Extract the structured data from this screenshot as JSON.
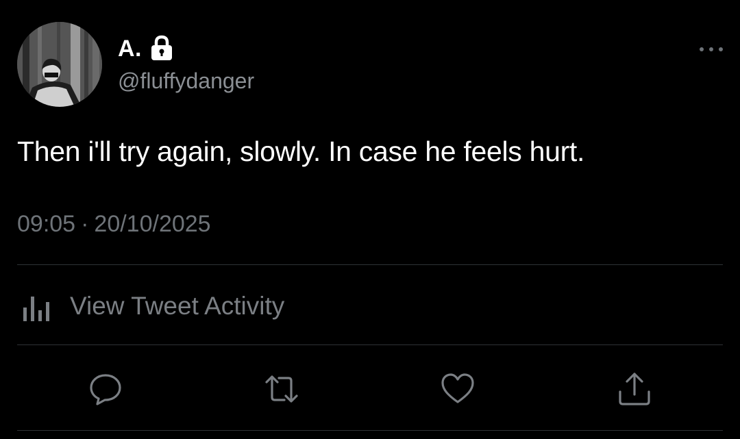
{
  "tweet": {
    "author": {
      "display_name": "A.",
      "handle": "@fluffydanger",
      "avatar_icon": "profile-photo",
      "protected_icon": "lock-icon"
    },
    "text": "Then i'll try again, slowly. In case he feels hurt.",
    "time": "09:05",
    "separator": "·",
    "date": "20/10/2025",
    "activity_label": "View Tweet Activity"
  },
  "actions": {
    "reply_icon": "reply-icon",
    "retweet_icon": "retweet-icon",
    "like_icon": "like-icon",
    "share_icon": "share-icon"
  },
  "colors": {
    "background": "#000000",
    "primary_text": "#ffffff",
    "secondary_text": "#6e7378",
    "divider": "#2f3336"
  }
}
